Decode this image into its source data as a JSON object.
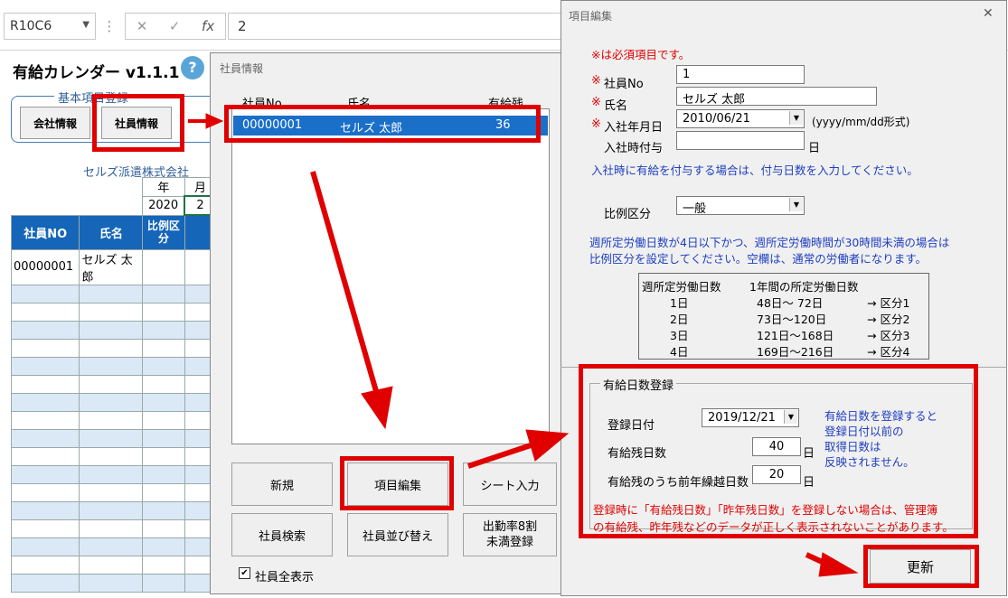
{
  "formula_bar": {
    "name_box": "R10C6",
    "cancel": "✕",
    "enter": "✓",
    "fx": "fx",
    "value": "2"
  },
  "sheet": {
    "title": "有給カレンダー v1.1.1",
    "help": "?",
    "group_label": "基本項目登録",
    "company_btn": "会社情報",
    "employee_btn": "社員情報",
    "company_name": "セルズ派遣株式会社",
    "year_label": "年",
    "month_label": "月",
    "year": "2020",
    "month": "2",
    "col_no": "社員NO",
    "col_name": "氏名",
    "col_ratio": "比例区分",
    "row1_no": "00000001",
    "row1_name": "セルズ 太郎"
  },
  "employee_dialog": {
    "title": "社員情報",
    "col_no": "社員No",
    "col_name": "氏名",
    "col_days": "有給残",
    "row": {
      "no": "00000001",
      "name": "セルズ 太郎",
      "days": "36"
    },
    "btn_new": "新規",
    "btn_edit": "項目編集",
    "btn_sheet": "シート入力",
    "btn_search": "社員検索",
    "btn_sort": "社員並び替え",
    "btn_attend": "出勤率8割\n未満登録",
    "show_all": "社員全表示",
    "check": "✔"
  },
  "edit_dialog": {
    "title": "項目編集",
    "close": "✕",
    "required_note": "※は必須項目です。",
    "mark": "※",
    "no_label": "社員No",
    "no_value": "1",
    "name_label": "氏名",
    "name_value": "セルズ 太郎",
    "join_label": "入社年月日",
    "join_value": "2010/06/21",
    "join_format": "(yyyy/mm/dd形式)",
    "grant_label": "入社時付与",
    "grant_value": "",
    "grant_unit": "日",
    "grant_note": "入社時に有給を付与する場合は、付与日数を入力してください。",
    "ratio_label": "比例区分",
    "ratio_value": "一般",
    "ratio_note1": "週所定労働日数が4日以下かつ、週所定労働時間が30時間未満の場合は",
    "ratio_note2": "比例区分を設定してください。空欄は、通常の労働者になります。",
    "table": {
      "h1": "週所定労働日数",
      "h2": "1年間の所定労働日数",
      "rows": [
        {
          "d": "1日",
          "r": "48日～ 72日",
          "c": "→ 区分1"
        },
        {
          "d": "2日",
          "r": "73日～120日",
          "c": "→ 区分2"
        },
        {
          "d": "3日",
          "r": "121日～168日",
          "c": "→ 区分3"
        },
        {
          "d": "4日",
          "r": "169日～216日",
          "c": "→ 区分4"
        }
      ]
    },
    "paid_group": "有給日数登録",
    "reg_date_label": "登録日付",
    "reg_date_value": "2019/12/21",
    "remain_label": "有給残日数",
    "remain_value": "40",
    "unit": "日",
    "carry_label": "有給残のうち前年繰越日数",
    "carry_value": "20",
    "blue_note": [
      "有給日数を登録すると",
      "登録日付以前の",
      "取得日数は",
      "反映されません。"
    ],
    "red_note1": "登録時に「有給残日数」「昨年残日数」を登録しない場合は、管理簿",
    "red_note2": "の有給残、昨年残などのデータが正しく表示されないことがあります。",
    "update_btn": "更新"
  },
  "colors": {
    "highlight": "#e00000",
    "accent": "#1a6fc9",
    "header": "#1565b8"
  }
}
